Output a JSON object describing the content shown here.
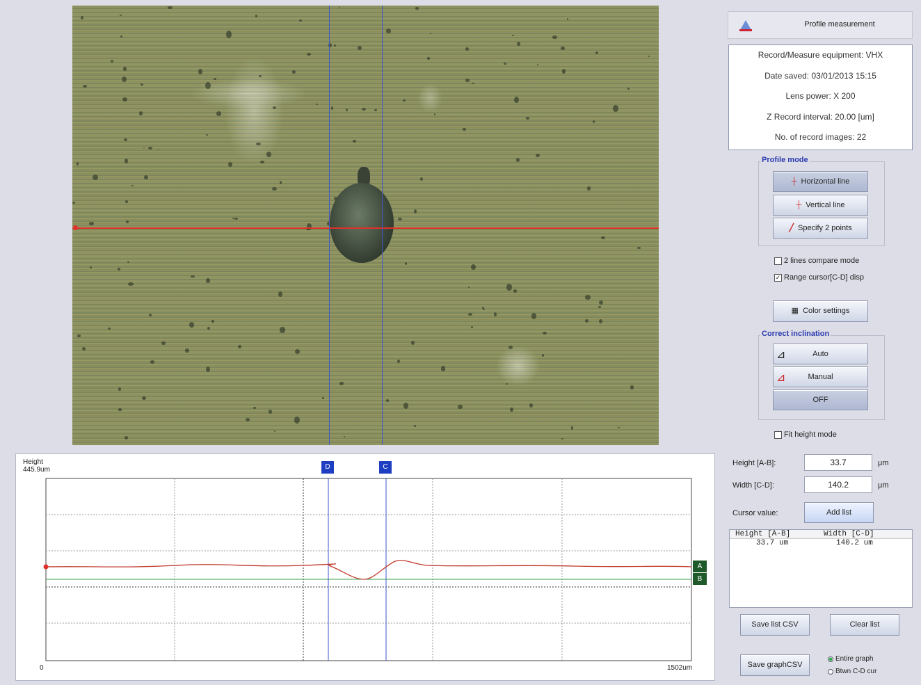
{
  "header": {
    "title": "Profile measurement"
  },
  "info": {
    "lines": [
      "Record/Measure equipment: VHX",
      "Date saved: 03/01/2013 15:15",
      "Lens power: X 200",
      "Z Record interval: 20.00 [um]",
      "No. of record images: 22"
    ]
  },
  "profile_mode": {
    "title": "Profile mode",
    "buttons": [
      "Horizontal line",
      "Vertical line",
      "Specify 2 points"
    ]
  },
  "options": {
    "compare": {
      "label": "2 lines compare mode",
      "checked": false
    },
    "range_cursor": {
      "label": "Range cursor[C-D] disp",
      "checked": true
    }
  },
  "color_settings_label": "Color settings",
  "correct_inclination": {
    "title": "Correct inclination",
    "buttons": [
      "Auto",
      "Manual",
      "OFF"
    ]
  },
  "fit_height": {
    "label": "Fit height mode",
    "checked": false
  },
  "measurements": {
    "height_label": "Height [A-B]:",
    "height_value": "33.7",
    "width_label": "Width [C-D]:",
    "width_value": "140.2",
    "unit": "μm",
    "cursor_value_label": "Cursor value:",
    "add_list_label": "Add list"
  },
  "list": {
    "headers": [
      "Height [A-B]",
      "Width [C-D]"
    ],
    "rows": [
      [
        "33.7 um",
        "140.2 um"
      ]
    ]
  },
  "buttons": {
    "save_list_csv": "Save list CSV",
    "clear_list": "Clear list",
    "save_graph_csv": "Save graphCSV"
  },
  "graph_range": {
    "options": [
      "Entire graph",
      "Btwn C-D cur"
    ],
    "selected": 0
  },
  "graph": {
    "ylabel": "Height",
    "ymax_label": "445.9um",
    "x_start_label": "0",
    "x_end_label": "1502um",
    "cursor_labels": {
      "d": "D",
      "c": "C",
      "a": "A",
      "b": "B"
    },
    "colors": {
      "profile": "#c0392b",
      "cursor": "#3b56c8",
      "ab_marker": "#1f5a2a",
      "b_line": "#3aa04a"
    }
  },
  "image": {
    "colors": {
      "hline": "#e0312a",
      "vline": "#3e58c4"
    }
  }
}
